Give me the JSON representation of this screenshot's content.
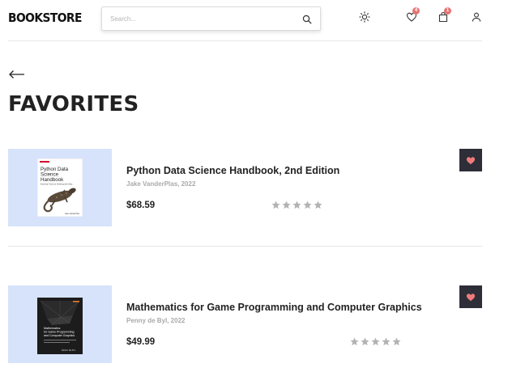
{
  "header": {
    "logo": "BOOKSTORE",
    "search_placeholder": "Search...",
    "favorites_count": "4",
    "cart_count": "1",
    "icons": [
      "search-icon",
      "sun-icon",
      "heart-icon",
      "bag-icon",
      "user-icon"
    ]
  },
  "page": {
    "title": "FAVORITES",
    "back_icon": "arrow-left-icon"
  },
  "favorites": [
    {
      "title": "Python Data Science Handbook, 2nd Edition",
      "meta": "Jake VanderPlas, 2022",
      "price": "$68.59",
      "rating": 0,
      "rating_max": 5,
      "cover_publisher": "O'REILLY",
      "cover_title_lines": [
        "Python Data",
        "Science",
        "Handbook"
      ],
      "cover_subtitle": "Essential Tools for Working with Data",
      "cover_author": "Jake VanderPlas"
    },
    {
      "title": "Mathematics for Game Programming and Computer Graphics",
      "meta": "Penny de Byl, 2022",
      "price": "$49.99",
      "rating": 0,
      "rating_max": 5,
      "cover_title_lines": [
        "Mathematics",
        "for Game Programming",
        "and Computer Graphics"
      ],
      "cover_author": "PENNY DE BYL"
    }
  ],
  "colors": {
    "cover_background": "#d6e3fb",
    "favorite_button": "#2e2e38",
    "heart": "#ef7b7b",
    "badge": "#e57373",
    "star": "#b3b3b3"
  }
}
